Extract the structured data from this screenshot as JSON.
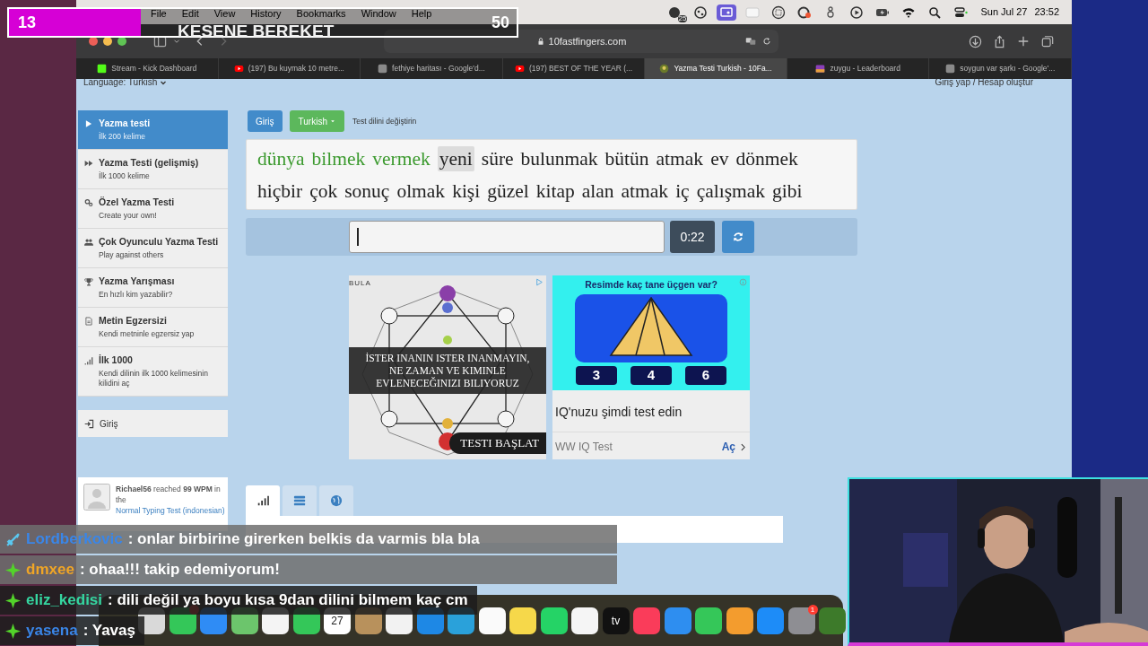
{
  "stream_goal": {
    "count": "13",
    "title": "KESENE BEREKET",
    "target": "50",
    "level": 0.26
  },
  "menu_bar": {
    "items": [
      "File",
      "Edit",
      "View",
      "History",
      "Bookmarks",
      "Window",
      "Help"
    ],
    "status_icons": [
      {
        "kind": "badge-clock",
        "label": "25",
        "active": false
      },
      {
        "kind": "palette",
        "active": false
      },
      {
        "kind": "screen",
        "active": true
      },
      {
        "kind": "card",
        "active": false
      },
      {
        "kind": "grid",
        "active": false
      },
      {
        "kind": "record",
        "active": false
      },
      {
        "kind": "figure",
        "active": false
      },
      {
        "kind": "play",
        "active": false
      },
      {
        "kind": "battery",
        "active": false
      },
      {
        "kind": "wifi",
        "active": false
      },
      {
        "kind": "search",
        "active": false
      },
      {
        "kind": "controls",
        "active": false
      }
    ],
    "date": "Sun Jul 27",
    "time": "23:52"
  },
  "browser": {
    "url": "10fastfingers.com",
    "tabs": [
      {
        "title": "Stream - Kick Dashboard",
        "kind": "kick",
        "selected": false
      },
      {
        "title": "(197) Bu kuymak 10 metre...",
        "kind": "video",
        "selected": false
      },
      {
        "title": "fethiye haritası - Google'd...",
        "kind": "google",
        "selected": false
      },
      {
        "title": "(197) BEST OF THE YEAR (...",
        "kind": "video",
        "selected": false
      },
      {
        "title": "Yazma Testi Turkish - 10Fa...",
        "kind": "site",
        "selected": true
      },
      {
        "title": "zuygu - Leaderboard",
        "kind": "game",
        "selected": false
      },
      {
        "title": "soygun var şarkı - Google'...",
        "kind": "google",
        "selected": false
      }
    ]
  },
  "page": {
    "language": "Language: Turkish",
    "account": "Giriş yap / Hesap oluştur",
    "sidebar": {
      "items": [
        {
          "kind": "play",
          "title": "Yazma testi",
          "subtitle": "İlk 200 kelime",
          "selected": true
        },
        {
          "kind": "forward",
          "title": "Yazma Testi (gelişmiş)",
          "subtitle": "İlk 1000 kelime",
          "selected": false
        },
        {
          "kind": "gears",
          "title": "Özel Yazma Testi",
          "subtitle": "Create your own!",
          "selected": false
        },
        {
          "kind": "users",
          "title": "Çok Oyunculu Yazma Testi",
          "subtitle": "Play against others",
          "selected": false
        },
        {
          "kind": "trophy",
          "title": "Yazma Yarışması",
          "subtitle": "En hızlı kim yazabilir?",
          "selected": false
        },
        {
          "kind": "file",
          "title": "Metin Egzersizi",
          "subtitle": "Kendi metninle egzersiz yap",
          "selected": false
        },
        {
          "kind": "signal",
          "title": "İlk 1000",
          "subtitle": "Kendi dilinin ilk 1000 kelimesinin kilidini aç",
          "selected": false
        }
      ],
      "login": "Giriş",
      "activity": {
        "text": "**Richael56** reached **99 WPM** in the",
        "link": "Normal Typing Test (indonesian)"
      }
    },
    "login_button": "Giriş",
    "language_button": "Turkish",
    "language_hint": "Test dilini değiştirin",
    "words": [
      [
        {
          "text": "dünya",
          "correct": true,
          "current": false
        },
        {
          "text": "bilmek",
          "correct": true,
          "current": false
        },
        {
          "text": "vermek",
          "correct": true,
          "current": false
        },
        {
          "text": "yeni",
          "correct": false,
          "current": true
        },
        {
          "text": "süre",
          "correct": false,
          "current": false
        },
        {
          "text": "bulunmak",
          "correct": false,
          "current": false
        },
        {
          "text": "bütün",
          "correct": false,
          "current": false
        },
        {
          "text": "atmak",
          "correct": false,
          "current": false
        },
        {
          "text": "ev",
          "correct": false,
          "current": false
        },
        {
          "text": "dönmek",
          "correct": false,
          "current": false
        }
      ],
      [
        {
          "text": "hiçbir",
          "correct": false,
          "current": false
        },
        {
          "text": "çok",
          "correct": false,
          "current": false
        },
        {
          "text": "sonuç",
          "correct": false,
          "current": false
        },
        {
          "text": "olmak",
          "correct": false,
          "current": false
        },
        {
          "text": "kişi",
          "correct": false,
          "current": false
        },
        {
          "text": "güzel",
          "correct": false,
          "current": false
        },
        {
          "text": "kitap",
          "correct": false,
          "current": false
        },
        {
          "text": "alan",
          "correct": false,
          "current": false
        },
        {
          "text": "atmak",
          "correct": false,
          "current": false
        },
        {
          "text": "iç",
          "correct": false,
          "current": false
        },
        {
          "text": "çalışmak",
          "correct": false,
          "current": false
        },
        {
          "text": "gibi",
          "correct": false,
          "current": false
        }
      ]
    ],
    "timer": "0:22",
    "ads": [
      {
        "kind": "horoscope",
        "brand": "BULA",
        "headline": [
          "İSTER INANIN ISTER INANMAYIN,",
          "NE ZAMAN VE KIMINLE",
          "EVLENECEĞINIZI BILIYORUZ"
        ],
        "button": "TESTI BAŞLAT"
      },
      {
        "kind": "quiz",
        "question": "Resimde kaç tane üçgen var?",
        "options": [
          "3",
          "4",
          "6"
        ],
        "headline": "IQ'nuzu şimdi test edin",
        "advertiser": "WW IQ Test",
        "cta": "Aç"
      }
    ],
    "stat_tabs": [
      {
        "kind": "chart",
        "selected": true
      },
      {
        "kind": "list",
        "selected": false
      },
      {
        "kind": "globe",
        "selected": false
      }
    ]
  },
  "chat": [
    {
      "user": "Lordberkovic",
      "kind": "sword",
      "color": "#3a86e8",
      "message": ": onlar birbirine girerken belkis da varmis bla bla"
    },
    {
      "user": "dmxee",
      "kind": "diamond",
      "color": "#f0a526",
      "message": ": ohaa!!! takip edemiyorum!"
    },
    {
      "user": "eliz_kedisi",
      "kind": "diamond",
      "color": "#35d6a0",
      "message": ": dili değil ya boyu kısa 9dan dilini bilmem kaç cm"
    },
    {
      "user": "yasena",
      "kind": "diamond",
      "color": "#3a86e8",
      "message": ": Yavaş"
    }
  ],
  "dock": [
    {
      "color": "#d9d9d9",
      "notified": false
    },
    {
      "color": "#34c759",
      "notified": true
    },
    {
      "color": "#2f8cf5",
      "notified": false
    },
    {
      "color": "#6cc56c",
      "notified": false
    },
    {
      "color": "#f4f4f4",
      "notified": false
    },
    {
      "color": "#34c759",
      "notified": false
    },
    {
      "color": "#ffffff",
      "label": "27",
      "notified": false
    },
    {
      "color": "#b8915c",
      "notified": false
    },
    {
      "color": "#f2f2f2",
      "notified": false
    },
    {
      "color": "#1e88e5",
      "notified": false
    },
    {
      "color": "#2aa1da",
      "notified": false
    },
    {
      "color": "#fafafa",
      "notified": false
    },
    {
      "color": "#f6d84a",
      "notified": false
    },
    {
      "color": "#25d366",
      "notified": false
    },
    {
      "color": "#f5f5f5",
      "notified": false
    },
    {
      "color": "#111111",
      "label": "tv",
      "notified": false
    },
    {
      "color": "#fa3c5a",
      "notified": false
    },
    {
      "color": "#2e8ef0",
      "notified": false
    },
    {
      "color": "#35c759",
      "notified": false
    },
    {
      "color": "#f39c2e",
      "notified": false
    },
    {
      "color": "#1d8cf8",
      "notified": false
    },
    {
      "color": "#8e8e93",
      "badge": "1",
      "notified": true
    },
    {
      "color": "#3d7a2a",
      "notified": false
    }
  ]
}
